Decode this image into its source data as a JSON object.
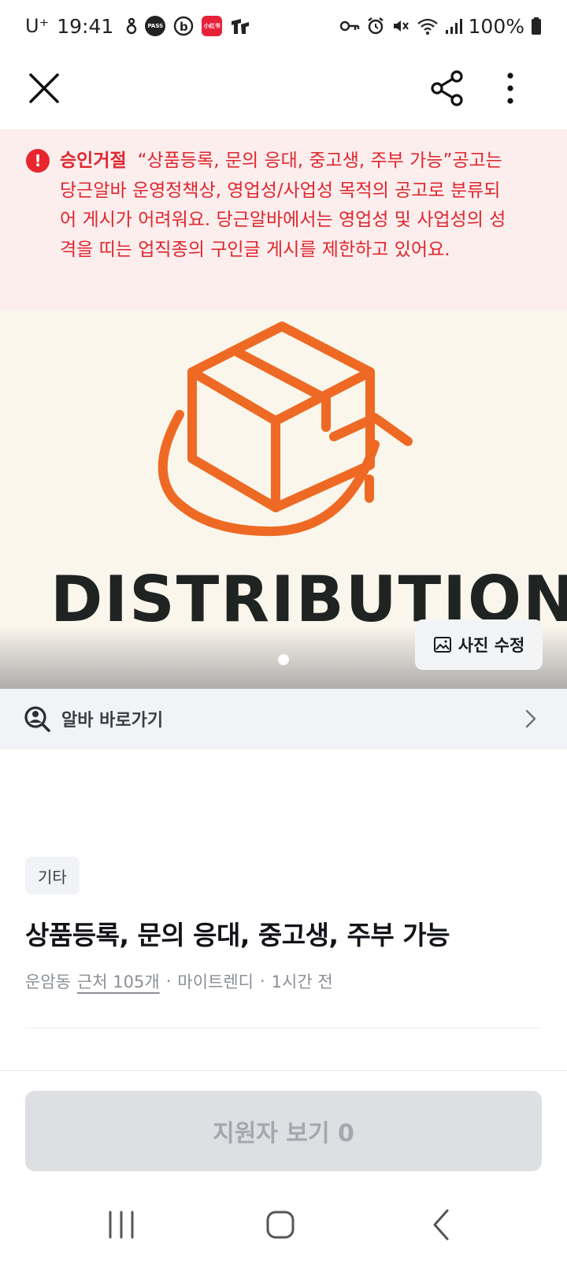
{
  "status_bar": {
    "carrier": "U⁺",
    "time": "19:41",
    "app_icons": [
      "pass-app-icon",
      "b-app-icon",
      "red-app-icon",
      "tt-app-icon"
    ],
    "pass_label": "PASS",
    "red_app_label": "小红书",
    "battery_percent": "100%"
  },
  "app_bar": {
    "close_icon": "close-icon",
    "share_icon": "share-icon",
    "more_icon": "more-vertical-icon"
  },
  "rejection": {
    "icon_text": "!",
    "label": "승인거절",
    "message": "“상품등록, 문의 응대, 중고생, 주부 가능”공고는 당근알바 운영정책상, 영업성/사업성 목적의 공고로 분류되어 게시가 어려워요. 당근알바에서는 영업성 및 사업성의 성격을 띠는 업직종의 구인글 게시를 제한하고 있어요.",
    "color": "#e0262d"
  },
  "hero": {
    "word": "DISTRIBUTION",
    "photo_edit_label": "사진 수정",
    "accent_color": "#ee6a24"
  },
  "shortcut": {
    "label": "알바 바로가기"
  },
  "post": {
    "category": "기타",
    "title": "상품등록, 문의 응대, 중고생, 주부 가능",
    "location": "운암동",
    "nearby_link": "근처 105개",
    "author": "마이트렌디",
    "time_ago": "1시간 전",
    "separator": "·"
  },
  "cta": {
    "label": "지원자 보기 0"
  }
}
